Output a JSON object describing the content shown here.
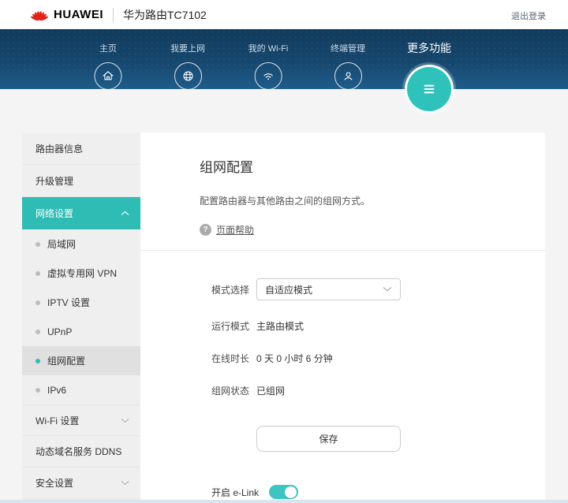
{
  "header": {
    "brand": "HUAWEI",
    "product": "华为路由TC7102",
    "logout": "退出登录"
  },
  "nav": {
    "items": [
      {
        "label": "主页",
        "icon": "home-icon"
      },
      {
        "label": "我要上网",
        "icon": "globe-icon"
      },
      {
        "label": "我的 Wi-Fi",
        "icon": "wifi-icon"
      },
      {
        "label": "终端管理",
        "icon": "user-icon"
      },
      {
        "label": "更多功能",
        "icon": "menu-icon",
        "active": true
      }
    ]
  },
  "sidebar": {
    "items": [
      {
        "label": "路由器信息"
      },
      {
        "label": "升级管理"
      },
      {
        "label": "网络设置",
        "expanded": true,
        "active": true
      },
      {
        "label": "局域网",
        "sub": true
      },
      {
        "label": "虚拟专用网 VPN",
        "sub": true
      },
      {
        "label": "IPTV 设置",
        "sub": true
      },
      {
        "label": "UPnP",
        "sub": true
      },
      {
        "label": "组网配置",
        "sub": true,
        "selected": true
      },
      {
        "label": "IPv6",
        "sub": true
      },
      {
        "label": "Wi-Fi 设置",
        "collapsible": true
      },
      {
        "label": "动态域名服务 DDNS"
      },
      {
        "label": "安全设置",
        "collapsible": true
      }
    ]
  },
  "main": {
    "title": "组网配置",
    "description": "配置路由器与其他路由之间的组网方式。",
    "help": {
      "label": "页面帮助",
      "icon": "help-icon"
    },
    "form": {
      "mode": {
        "label": "模式选择",
        "value": "自适应模式"
      },
      "run_mode": {
        "label": "运行模式",
        "value": "主路由模式"
      },
      "online_time": {
        "label": "在线时长",
        "value": "0 天 0 小时 6 分钟"
      },
      "status": {
        "label": "组网状态",
        "value": "已组网"
      },
      "save_label": "保存",
      "elink": {
        "label": "开启 e-Link",
        "state": "on"
      }
    }
  },
  "colors": {
    "accent_teal": "#2fbcb4",
    "toggle_teal": "#3fc4c1",
    "nav_blue_top": "#113a5b",
    "nav_blue_bottom": "#1e5d8a",
    "huawei_red": "#e2231a",
    "help_text": "#555555"
  }
}
